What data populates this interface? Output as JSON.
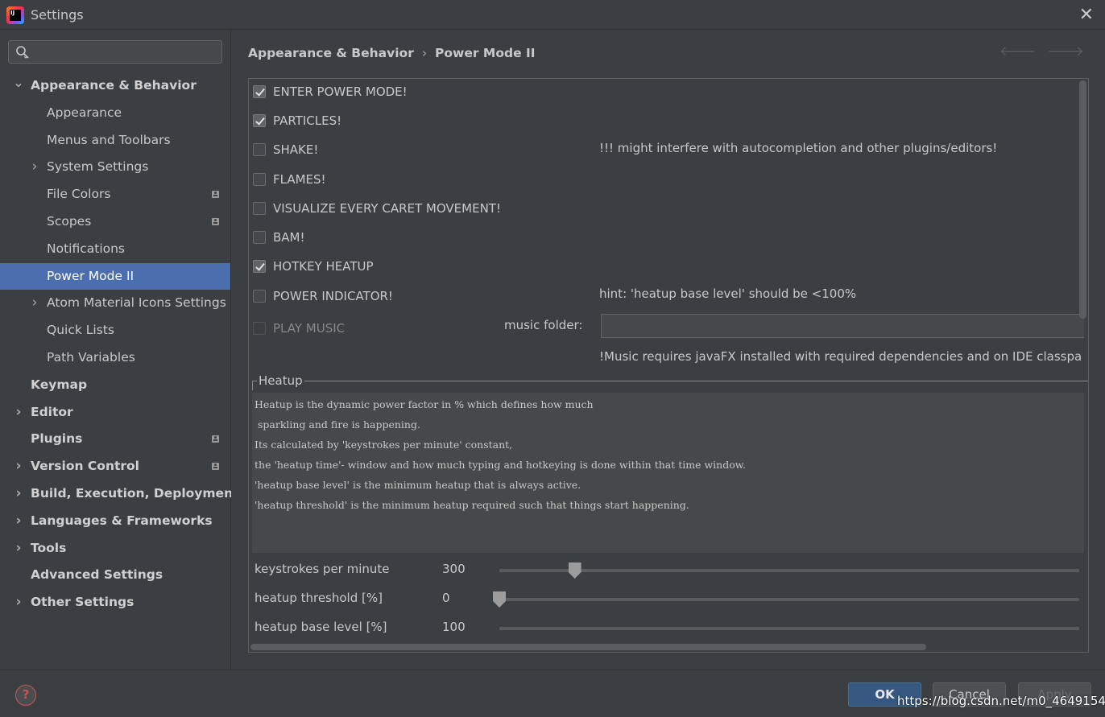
{
  "window": {
    "title": "Settings",
    "logo_text": "IJ"
  },
  "search": {
    "value": "",
    "placeholder": ""
  },
  "sidebar": {
    "items": [
      {
        "label": "Appearance & Behavior",
        "level": 0,
        "bold": true,
        "arrow": "expanded"
      },
      {
        "label": "Appearance",
        "level": 1
      },
      {
        "label": "Menus and Toolbars",
        "level": 1
      },
      {
        "label": "System Settings",
        "level": 1,
        "arrow": "collapsed"
      },
      {
        "label": "File Colors",
        "level": 1,
        "badge": true
      },
      {
        "label": "Scopes",
        "level": 1,
        "badge": true
      },
      {
        "label": "Notifications",
        "level": 1
      },
      {
        "label": "Power Mode II",
        "level": 1,
        "selected": true
      },
      {
        "label": "Atom Material Icons Settings",
        "level": 1,
        "arrow": "collapsed"
      },
      {
        "label": "Quick Lists",
        "level": 1
      },
      {
        "label": "Path Variables",
        "level": 1
      },
      {
        "label": "Keymap",
        "level": 0,
        "bold": true
      },
      {
        "label": "Editor",
        "level": 0,
        "bold": true,
        "arrow": "collapsed"
      },
      {
        "label": "Plugins",
        "level": 0,
        "bold": true,
        "badge": true
      },
      {
        "label": "Version Control",
        "level": 0,
        "bold": true,
        "arrow": "collapsed",
        "badge": true
      },
      {
        "label": "Build, Execution, Deployment",
        "level": 0,
        "bold": true,
        "arrow": "collapsed"
      },
      {
        "label": "Languages & Frameworks",
        "level": 0,
        "bold": true,
        "arrow": "collapsed"
      },
      {
        "label": "Tools",
        "level": 0,
        "bold": true,
        "arrow": "collapsed"
      },
      {
        "label": "Advanced Settings",
        "level": 0,
        "bold": true
      },
      {
        "label": "Other Settings",
        "level": 0,
        "bold": true,
        "arrow": "collapsed"
      }
    ]
  },
  "breadcrumb": {
    "parent": "Appearance & Behavior",
    "separator": "›",
    "current": "Power Mode II"
  },
  "options": {
    "enter_power_mode": {
      "label": "ENTER POWER MODE!",
      "checked": true
    },
    "particles": {
      "label": "PARTICLES!",
      "checked": true
    },
    "shake": {
      "label": "SHAKE!",
      "checked": false
    },
    "flames": {
      "label": "FLAMES!",
      "checked": false
    },
    "visualize_caret": {
      "label": "VISUALIZE EVERY CARET MOVEMENT!",
      "checked": false
    },
    "bam": {
      "label": "BAM!",
      "checked": false
    },
    "hotkey_heatup": {
      "label": "HOTKEY HEATUP",
      "checked": true
    },
    "power_indicator": {
      "label": "POWER INDICATOR!",
      "checked": false
    },
    "play_music": {
      "label": "PLAY MUSIC",
      "checked": false,
      "disabled": true
    }
  },
  "hints": {
    "shake": "!!! might interfere with autocompletion and other plugins/editors!",
    "power_indicator": "hint: 'heatup base level' should be <100%",
    "music": "!Music requires javaFX installed with required dependencies and on IDE classpa"
  },
  "music_folder": {
    "label": "music folder:",
    "value": ""
  },
  "heatup": {
    "group_title": "Heatup",
    "description": [
      "Heatup is the dynamic power factor in % which defines how much",
      " sparkling and fire is happening.",
      "Its calculated by 'keystrokes per minute' constant,",
      "the 'heatup time'- window and how much typing and hotkeying is done within that time window.",
      "'heatup base level' is the minimum heatup that is always active.",
      "'heatup threshold' is the minimum heatup required such that things start happening."
    ],
    "sliders": [
      {
        "label": "keystrokes per minute",
        "value": "300",
        "position": 0.13
      },
      {
        "label": "heatup threshold [%]",
        "value": "0",
        "position": 0.0
      },
      {
        "label": "heatup base level [%]",
        "value": "100",
        "position": null
      }
    ]
  },
  "footer": {
    "ok": "OK",
    "cancel": "Cancel",
    "apply": "Apply",
    "watermark": "https://blog.csdn.net/m0_46491549"
  },
  "colors": {
    "background": "#3c3f41",
    "selection": "#4b6eaf",
    "ok_button": "#365880"
  }
}
